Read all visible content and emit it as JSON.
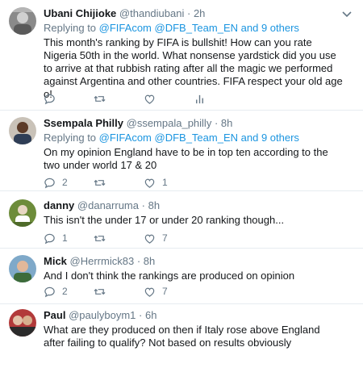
{
  "tweets": [
    {
      "name": "Ubani Chijioke",
      "handle": "@thandiubani",
      "time": "2h",
      "replying_prefix": "Replying to",
      "mentions": [
        "@FIFAcom",
        "@DFB_Team_EN"
      ],
      "others": "and 9 others",
      "text": "This month's ranking by FIFA is bullshit! How can you rate Nigeria 50th in the world. What nonsense yardstick did you use to arrive at that rubbish rating after all the magic we performed against Argentina and other countries. FIFA respect your old age o!",
      "replies": "",
      "retweets": "",
      "likes": ""
    },
    {
      "name": "Ssempala Philly",
      "handle": "@ssempala_philly",
      "time": "8h",
      "replying_prefix": "Replying to",
      "mentions": [
        "@FIFAcom",
        "@DFB_Team_EN"
      ],
      "others": "and 9 others",
      "text": "On my opinion England have to be in top ten according to the two under world 17 & 20",
      "replies": "2",
      "retweets": "",
      "likes": "1"
    },
    {
      "name": "danny",
      "handle": "@danarruma",
      "time": "8h",
      "text": "This isn't the under 17 or under 20 ranking though...",
      "replies": "1",
      "retweets": "",
      "likes": "7"
    },
    {
      "name": "Mick",
      "handle": "@Herrmick83",
      "time": "8h",
      "text": "And I don't think the rankings are produced on opinion",
      "replies": "2",
      "retweets": "",
      "likes": "7"
    },
    {
      "name": "Paul",
      "handle": "@paulyboym1",
      "time": "6h",
      "text": "What are they produced on then if Italy rose above England after failing to qualify? Not based on results obviously",
      "replies": "",
      "retweets": "",
      "likes": ""
    }
  ],
  "separator": "·",
  "icons": {
    "reply": "reply-icon",
    "retweet": "retweet-icon",
    "like": "heart-icon",
    "analytics": "analytics-icon",
    "menu": "chevron-down-icon"
  },
  "colors": {
    "link": "#1b95e0",
    "secondary": "#657786",
    "divider": "#e6ecf0"
  }
}
